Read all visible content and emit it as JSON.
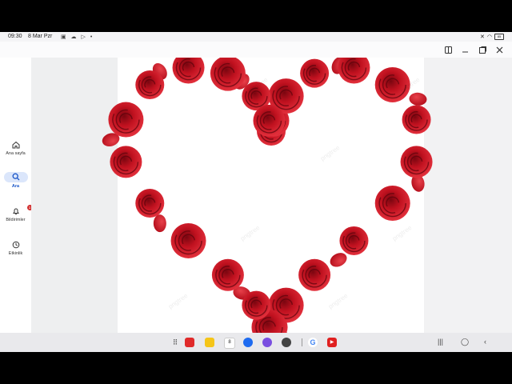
{
  "status": {
    "time": "09:30",
    "date": "8 Mar Pzr",
    "battery": "85"
  },
  "nav": {
    "items": [
      {
        "label": "Ana sayfa",
        "icon": "home-icon"
      },
      {
        "label": "Ara",
        "icon": "search-icon",
        "active": true
      },
      {
        "label": "Bildirimler",
        "icon": "bell-icon",
        "badge": "1"
      },
      {
        "label": "Etkinlik",
        "icon": "clock-icon"
      }
    ]
  },
  "content": {
    "image": "heart-of-red-roses",
    "watermark": "pngtree"
  },
  "taskbar": {
    "calendar_day": "8",
    "apps": [
      "app-drawer-icon",
      "red-app-icon",
      "notes-app-icon",
      "calendar-app-icon",
      "messages-app-icon",
      "purple-app-icon",
      "camera-app-icon",
      "google-app-icon",
      "youtube-app-icon"
    ]
  },
  "colors": {
    "accent": "#1a56c8",
    "rose": "#c0111f",
    "badge": "#d32f2f"
  }
}
